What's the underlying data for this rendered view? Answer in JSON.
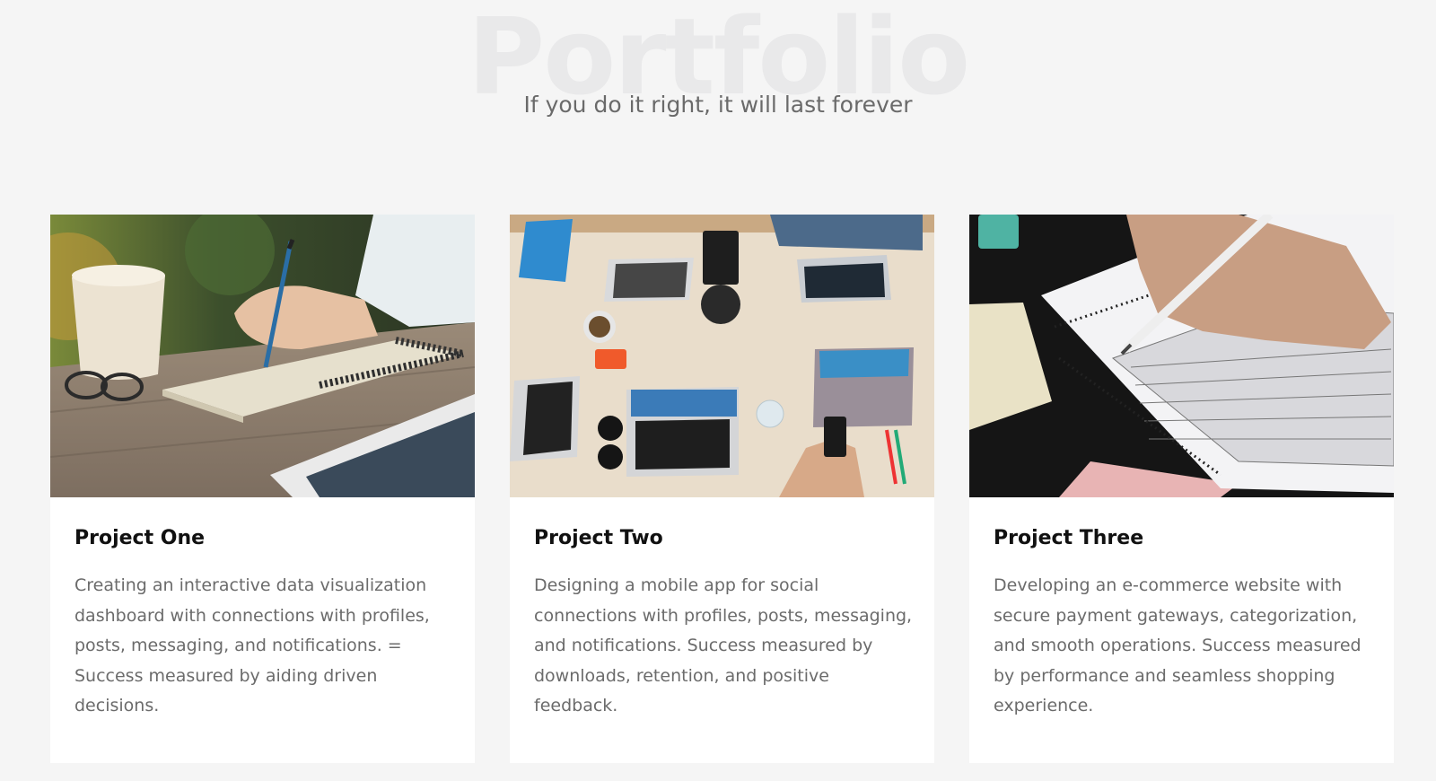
{
  "header": {
    "background_title": "Portfolio",
    "subtitle": "If you do it right, it will last forever"
  },
  "projects": [
    {
      "title": "Project One",
      "description": "Creating an interactive data visualization dashboard with connections with profiles, posts, messaging, and notifications. = Success measured by aiding driven decisions.",
      "image": "notebook-writing-photo"
    },
    {
      "title": "Project Two",
      "description": "Designing a mobile app for social connections with profiles, posts, messaging, and notifications. Success measured by downloads, retention, and positive feedback.",
      "image": "team-laptops-desk-photo"
    },
    {
      "title": "Project Three",
      "description": "Developing an e-commerce website with secure payment gateways, categorization, and smooth operations. Success measured by performance and seamless shopping experience.",
      "image": "answer-sheet-pencil-photo"
    }
  ],
  "colors": {
    "page_background": "#f5f5f5",
    "card_background": "#ffffff",
    "title_text": "#111111",
    "body_text": "#6b6b6b",
    "watermark_text": "#e9e9ea"
  }
}
